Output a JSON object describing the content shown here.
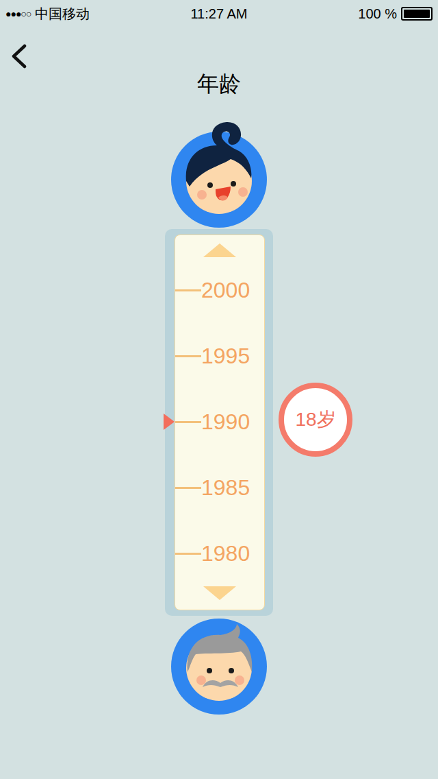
{
  "status_bar": {
    "signal": "●●●○○",
    "carrier": "中国移动",
    "time": "11:27 AM",
    "battery": "100 %",
    "battery_level": 1
  },
  "nav": {
    "title": "年龄"
  },
  "picker": {
    "years": [
      {
        "label": "2000",
        "selected": false
      },
      {
        "label": "1995",
        "selected": false
      },
      {
        "label": "1990",
        "selected": true
      },
      {
        "label": "1985",
        "selected": false
      },
      {
        "label": "1980",
        "selected": false
      }
    ],
    "age_badge": "18岁"
  }
}
